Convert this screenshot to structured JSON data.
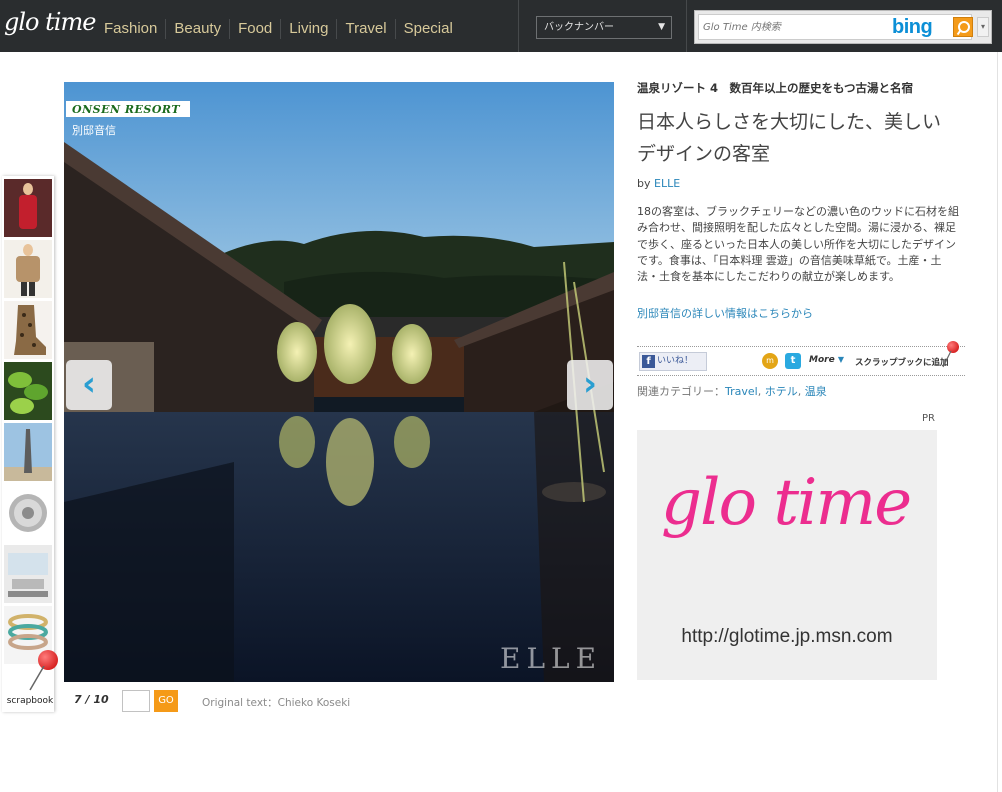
{
  "header": {
    "logo": "glo time",
    "nav": [
      "Fashion",
      "Beauty",
      "Food",
      "Living",
      "Travel",
      "Special"
    ],
    "backnumber_label": "バックナンバー",
    "search": {
      "placeholder": "Glo Time 内検索",
      "brand": "bing"
    }
  },
  "scrapbook": {
    "label": "scrapbook",
    "thumbnails": [
      "thumb-red-dress",
      "thumb-fashion-jacket",
      "thumb-leopard-boots",
      "thumb-green-leaves",
      "thumb-tower",
      "thumb-silver-badge",
      "thumb-interior",
      "thumb-bangles"
    ]
  },
  "gallery": {
    "badge": "ONSEN RESORT",
    "badge_sub": "別邸音信",
    "watermark": "ELLE",
    "prev_arrow": "‹",
    "next_arrow": "›",
    "current": 7,
    "total": 10,
    "counter_text": "7 / 10",
    "go_label": "GO",
    "original_text": "Original text：Chieko Koseki"
  },
  "article": {
    "kicker": "温泉リゾート 4　数百年以上の歴史をもつ古湯と名宿",
    "headline": "日本人らしさを大切にした、美しいデザインの客室",
    "byline_prefix": "by",
    "byline_author": "ELLE",
    "body": "18の客室は、ブラックチェリーなどの濃い色のウッドに石材を組み合わせ、間接照明を配した広々とした空間。湯に浸かる、裸足で歩く、座るといった日本人の美しい所作を大切にしたデザインです。食事は、「日本料理 雲遊」の音信美味草紙で。土産・土法・土食を基本にしたこだわりの献立が楽しめます。",
    "more_link": "別邸音信の詳しい情報はこちらから",
    "share": {
      "like_label": "いいね！",
      "more_label": "More",
      "scrap_label": "スクラップブックに追加"
    },
    "related": {
      "label": "関連カテゴリー：",
      "links": [
        "Travel",
        "ホテル",
        "温泉"
      ]
    }
  },
  "ad": {
    "pr_label": "PR",
    "logo": "glo time",
    "url": "http://glotime.jp.msn.com"
  }
}
